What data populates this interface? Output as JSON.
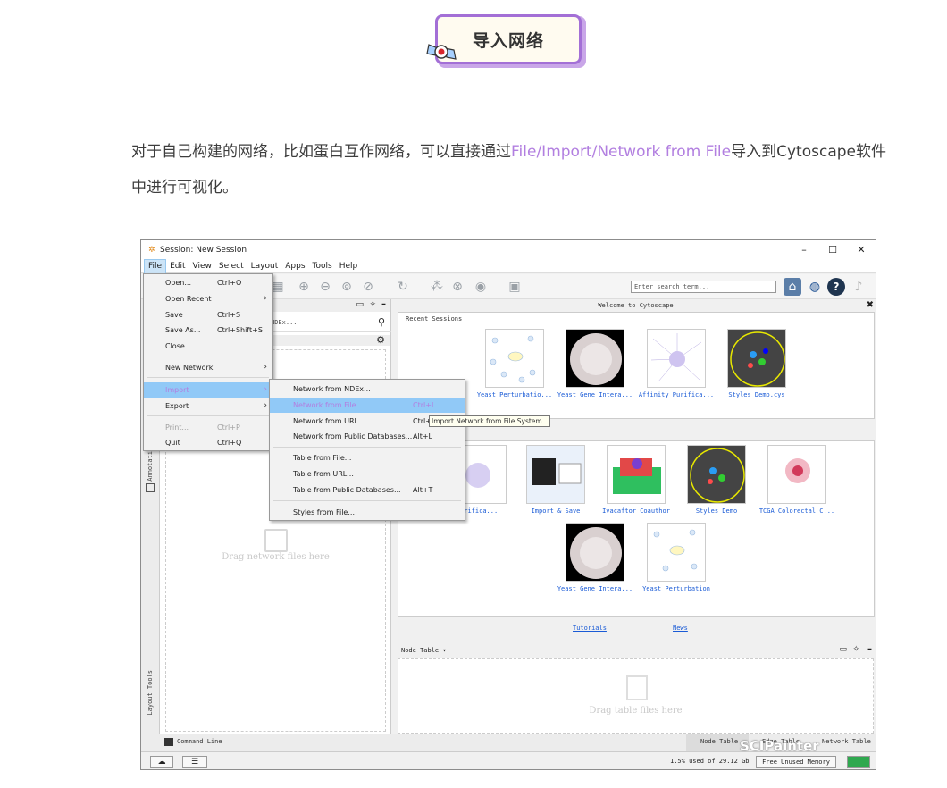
{
  "header": {
    "badge_text": "导入网络"
  },
  "intro": {
    "part1": "对于自己构建的网络，比如蛋白互作网络，可以直接通过",
    "highlight": "File/Import/Network from File",
    "part2": "导入到Cytoscape软件中进行可视化。"
  },
  "colors": {
    "accent_purple": "#b27fe0",
    "badge_border": "#a36fd6",
    "link_blue": "#1a5bd6",
    "menu_highlight": "#91c9f7"
  },
  "window": {
    "title": "Session: New Session",
    "controls": [
      "–",
      "☐",
      "✕"
    ],
    "menubar": [
      "File",
      "Edit",
      "View",
      "Select",
      "Layout",
      "Apps",
      "Tools",
      "Help"
    ],
    "search_placeholder": "Enter search term..."
  },
  "left_panel": {
    "search_text": "NDEx...",
    "drag_text": "Drag network files here",
    "vertical_tabs": [
      "Annotati",
      "Layout Tools"
    ]
  },
  "welcome": {
    "title": "Welcome to Cytoscape",
    "recent_label": "Recent Sessions",
    "recent": [
      "Yeast Perturbatio...",
      "Yeast Gene Intera...",
      "Affinity Purifica...",
      "Styles Demo.cys"
    ],
    "samples_row1": [
      "Purifica...",
      "Import & Save",
      "Ivacaftor Coauthor",
      "Styles Demo",
      "TCGA Colorectal C..."
    ],
    "samples_row2": [
      "Yeast Gene Intera...",
      "Yeast Perturbation"
    ],
    "links": {
      "tutorials": "Tutorials",
      "news": "News"
    }
  },
  "node_table": {
    "label": "Node Table ▾",
    "drag_text": "Drag table files here"
  },
  "bottom_tabs": {
    "command_line": "Command Line",
    "node_table": "Node Table",
    "edge_table": "Edge Table",
    "network_table": "Network Table"
  },
  "status": {
    "memory": "1.5% used of 29.12 Gb",
    "free_button": "Free Unused Memory"
  },
  "file_menu": {
    "items": [
      {
        "label": "Open...",
        "shortcut": "Ctrl+O"
      },
      {
        "label": "Open Recent",
        "shortcut": ""
      },
      {
        "label": "Save",
        "shortcut": "Ctrl+S"
      },
      {
        "label": "Save As...",
        "shortcut": "Ctrl+Shift+S"
      },
      {
        "label": "Close",
        "shortcut": ""
      },
      {
        "label": "New Network",
        "shortcut": ""
      },
      {
        "label": "Import",
        "shortcut": ""
      },
      {
        "label": "Export",
        "shortcut": ""
      },
      {
        "label": "Print...",
        "shortcut": "Ctrl+P"
      },
      {
        "label": "Quit",
        "shortcut": "Ctrl+Q"
      }
    ]
  },
  "import_menu": {
    "items": [
      {
        "label": "Network from NDEx...",
        "shortcut": ""
      },
      {
        "label": "Network from File...",
        "shortcut": "Ctrl+L"
      },
      {
        "label": "Network from URL...",
        "shortcut": "Ctrl+"
      },
      {
        "label": "Network from Public Databases...",
        "shortcut": "Alt+L"
      },
      {
        "label": "Table from File...",
        "shortcut": ""
      },
      {
        "label": "Table from URL...",
        "shortcut": ""
      },
      {
        "label": "Table from Public Databases...",
        "shortcut": "Alt+T"
      },
      {
        "label": "Styles from File...",
        "shortcut": ""
      }
    ]
  },
  "tooltip": "Import Network from File System",
  "watermark": "SCIPainter"
}
